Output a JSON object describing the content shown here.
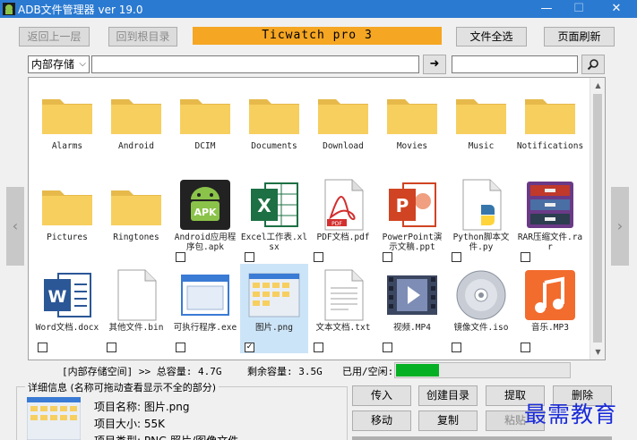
{
  "window": {
    "title": "ADB文件管理器 ver 19.0",
    "minimize": "—",
    "maximize": "☐",
    "close": "✕"
  },
  "toolbar": {
    "back_label": "返回上一层",
    "root_label": "回到根目录",
    "device_name": "Ticwatch pro 3",
    "select_all_label": "文件全选",
    "refresh_label": "页面刷新"
  },
  "pathbar": {
    "storage_selected": "内部存储",
    "path_value": "",
    "go_glyph": "➜",
    "search_value": "",
    "search_glyph": "🔍"
  },
  "files": [
    {
      "name": "Alarms",
      "type": "folder"
    },
    {
      "name": "Android",
      "type": "folder"
    },
    {
      "name": "DCIM",
      "type": "folder"
    },
    {
      "name": "Documents",
      "type": "folder"
    },
    {
      "name": "Download",
      "type": "folder"
    },
    {
      "name": "Movies",
      "type": "folder"
    },
    {
      "name": "Music",
      "type": "folder"
    },
    {
      "name": "Notifications",
      "type": "folder"
    },
    {
      "name": "Pictures",
      "type": "folder"
    },
    {
      "name": "Ringtones",
      "type": "folder"
    },
    {
      "name": "Android应用程序包.apk",
      "type": "apk",
      "checked": false
    },
    {
      "name": "Excel工作表.xlsx",
      "type": "xlsx",
      "checked": false
    },
    {
      "name": "PDF文档.pdf",
      "type": "pdf",
      "checked": false
    },
    {
      "name": "PowerPoint演示文稿.ppt",
      "type": "ppt",
      "checked": false
    },
    {
      "name": "Python脚本文件.py",
      "type": "py",
      "checked": false
    },
    {
      "name": "RAR压缩文件.rar",
      "type": "rar",
      "checked": false
    },
    {
      "name": "Word文档.docx",
      "type": "docx",
      "checked": false
    },
    {
      "name": "其他文件.bin",
      "type": "bin",
      "checked": false
    },
    {
      "name": "可执行程序.exe",
      "type": "exe",
      "checked": false
    },
    {
      "name": "图片.png",
      "type": "png",
      "checked": true
    },
    {
      "name": "文本文档.txt",
      "type": "txt",
      "checked": false
    },
    {
      "name": "视频.MP4",
      "type": "mp4",
      "checked": false
    },
    {
      "name": "镜像文件.iso",
      "type": "iso",
      "checked": false
    },
    {
      "name": "音乐.MP3",
      "type": "mp3",
      "checked": false
    }
  ],
  "selected_file": "图片.png",
  "nav": {
    "prev_glyph": "‹",
    "next_glyph": "›"
  },
  "status": {
    "space_label": "[内部存储空间] >> 总容量: 4.7G",
    "free_label": "剩余容量: 3.5G",
    "used_label": "已用/空闲:",
    "used_fraction": 0.25
  },
  "details": {
    "legend": "详细信息 (名称可拖动查看显示不全的部分)",
    "name_line": "项目名称: 图片.png",
    "size_line": "项目大小: 55K",
    "type_line": "项目类型: PNG 照片/图像文件"
  },
  "actions": {
    "upload": "传入",
    "create_dir": "创建目录",
    "extract": "提取",
    "delete": "删除",
    "move": "移动",
    "copy": "复制",
    "paste": "粘贴"
  },
  "watermark": "最需教育",
  "colors": {
    "titlebar": "#2b7ad1",
    "device_banner": "#f5a623",
    "folder": "#f7cf5f",
    "progress": "#06b025",
    "selection": "#cce4f7",
    "watermark": "#1a2bd8"
  }
}
